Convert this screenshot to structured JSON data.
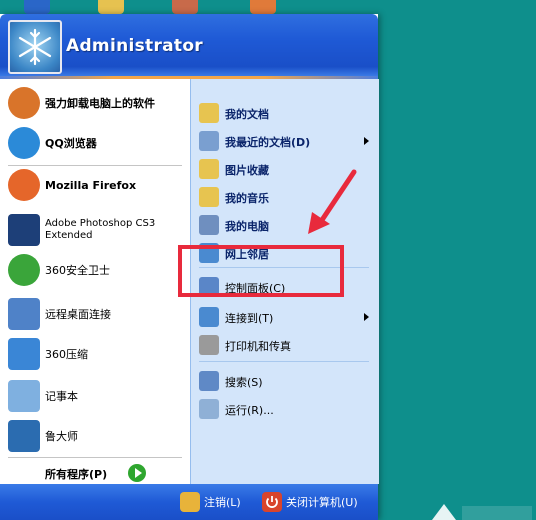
{
  "desktop_icons": [
    "star-icon",
    "folder-icon",
    "app-icon",
    "anime-icon"
  ],
  "user": {
    "name": "Administrator"
  },
  "pinned": [
    {
      "name": "pinned-uninstaller",
      "label": "强力卸载电脑上的软件",
      "icon": "uninstall-icon",
      "color": "#d9742a"
    },
    {
      "name": "pinned-qqbrowser",
      "label": "QQ浏览器",
      "icon": "qq-browser-icon",
      "color": "#2b8ad8"
    }
  ],
  "recent": [
    {
      "name": "recent-firefox",
      "label": "Mozilla Firefox",
      "icon": "firefox-icon",
      "color": "#e5662a"
    },
    {
      "name": "recent-photoshop",
      "label": "Adobe Photoshop CS3 Extended",
      "line1": "Adobe Photoshop CS3",
      "line2": "Extended",
      "icon": "photoshop-icon",
      "color": "#1d3f78"
    },
    {
      "name": "recent-360safe",
      "label": "360安全卫士",
      "icon": "360-safe-icon",
      "color": "#3aa53a"
    },
    {
      "name": "recent-remote-desktop",
      "label": "远程桌面连接",
      "icon": "remote-desktop-icon",
      "color": "#4f82c8"
    },
    {
      "name": "recent-360zip",
      "label": "360压缩",
      "icon": "360-zip-icon",
      "color": "#3a86d6"
    },
    {
      "name": "recent-notepad",
      "label": "记事本",
      "icon": "notepad-icon",
      "color": "#7fb0e0"
    },
    {
      "name": "recent-ludashi",
      "label": "鲁大师",
      "icon": "ludashi-icon",
      "color": "#2b6cb0"
    }
  ],
  "all_programs": {
    "label": "所有程序(P)",
    "icon": "green-arrow-icon"
  },
  "right_items": [
    {
      "name": "my-documents",
      "label": "我的文档",
      "icon": "folder-docs-icon",
      "color": "#e7c450",
      "arrow": false
    },
    {
      "name": "recent-documents",
      "label": "我最近的文档(D)",
      "icon": "recent-docs-icon",
      "color": "#7a9fd0",
      "arrow": true
    },
    {
      "name": "my-pictures",
      "label": "图片收藏",
      "icon": "folder-pictures-icon",
      "color": "#e7c450",
      "arrow": false
    },
    {
      "name": "my-music",
      "label": "我的音乐",
      "icon": "folder-music-icon",
      "color": "#e7c450",
      "arrow": false
    },
    {
      "name": "my-computer",
      "label": "我的电脑",
      "icon": "computer-icon",
      "color": "#6f8fbf",
      "arrow": false
    },
    {
      "name": "network-places",
      "label": "网上邻居",
      "icon": "network-icon",
      "color": "#4a8ad0",
      "arrow": false
    },
    {
      "name": "control-panel",
      "label": "控制面板(C)",
      "icon": "control-panel-icon",
      "color": "#5a86c8",
      "arrow": false,
      "thin": true
    },
    {
      "name": "connect-to",
      "label": "连接到(T)",
      "icon": "connect-icon",
      "color": "#4a8ad0",
      "arrow": true,
      "thin": true
    },
    {
      "name": "printers-faxes",
      "label": "打印机和传真",
      "icon": "printer-icon",
      "color": "#9a9a9a",
      "arrow": false,
      "thin": true
    },
    {
      "name": "search",
      "label": "搜索(S)",
      "icon": "search-icon",
      "color": "#5f89c6",
      "arrow": false,
      "thin": true
    },
    {
      "name": "run",
      "label": "运行(R)...",
      "icon": "run-icon",
      "color": "#8fb0d6",
      "arrow": false,
      "thin": true
    }
  ],
  "footer": {
    "logoff": {
      "label": "注销(L)",
      "icon": "key-icon"
    },
    "shutdown": {
      "label": "关闭计算机(U)",
      "icon": "power-icon"
    }
  },
  "accent": {
    "highlight": "#e82a3c",
    "header_blue": "#1f5ad6"
  }
}
